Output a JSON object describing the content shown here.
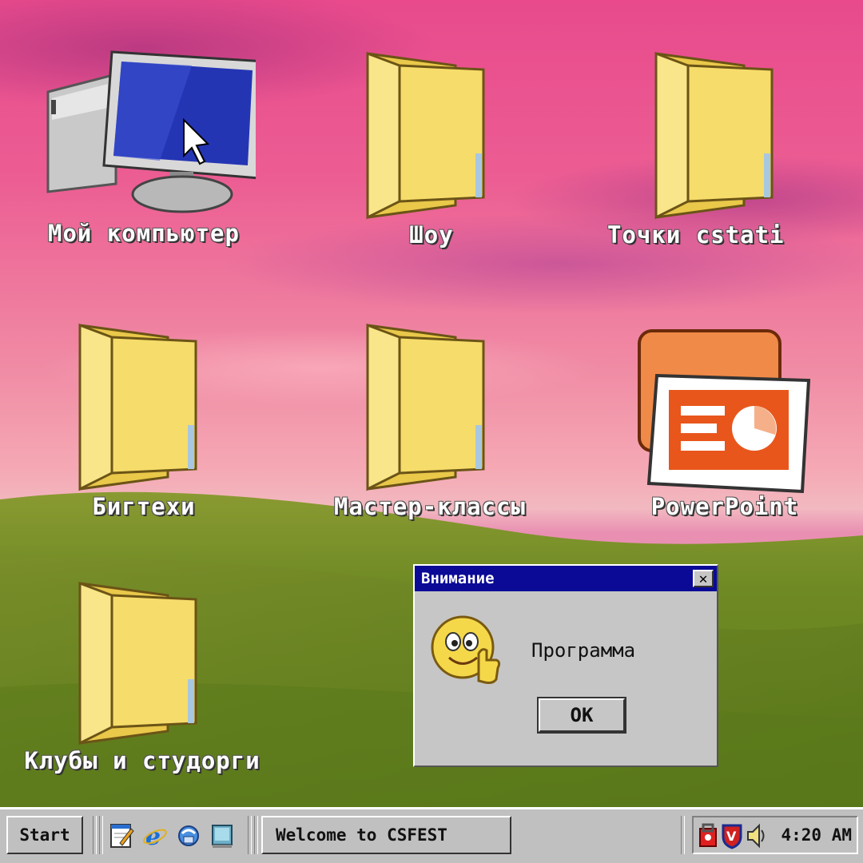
{
  "desktop": {
    "icons": [
      {
        "label": "Мой компьютер",
        "icon": "my-computer-icon"
      },
      {
        "label": "Шоу",
        "icon": "folder-icon"
      },
      {
        "label": "Точки cstati",
        "icon": "folder-icon"
      },
      {
        "label": "Бигтехи",
        "icon": "folder-icon"
      },
      {
        "label": "Мастер-классы",
        "icon": "folder-icon"
      },
      {
        "label": "PowerPoint",
        "icon": "powerpoint-icon"
      },
      {
        "label": "Клубы и студорги",
        "icon": "folder-icon"
      }
    ]
  },
  "dialog": {
    "title": "Внимание",
    "close_label": "✕",
    "message": "Программа",
    "ok_label": "OK",
    "icon": "thumbs-up-smiley-icon"
  },
  "taskbar": {
    "start_label": "Start",
    "quick_launch": [
      "notepad-icon",
      "internet-explorer-icon",
      "network-icon",
      "desktop-icon"
    ],
    "task_label": "Welcome to CSFEST",
    "tray_icons": [
      "security-icon",
      "antivirus-shield-icon",
      "volume-icon"
    ],
    "clock": "4:20 AM"
  },
  "colors": {
    "title_bar": "#0a0a96",
    "window_face": "#c6c6c6",
    "folder_yellow": "#f6dc6a",
    "powerpoint_orange": "#e8561c"
  }
}
